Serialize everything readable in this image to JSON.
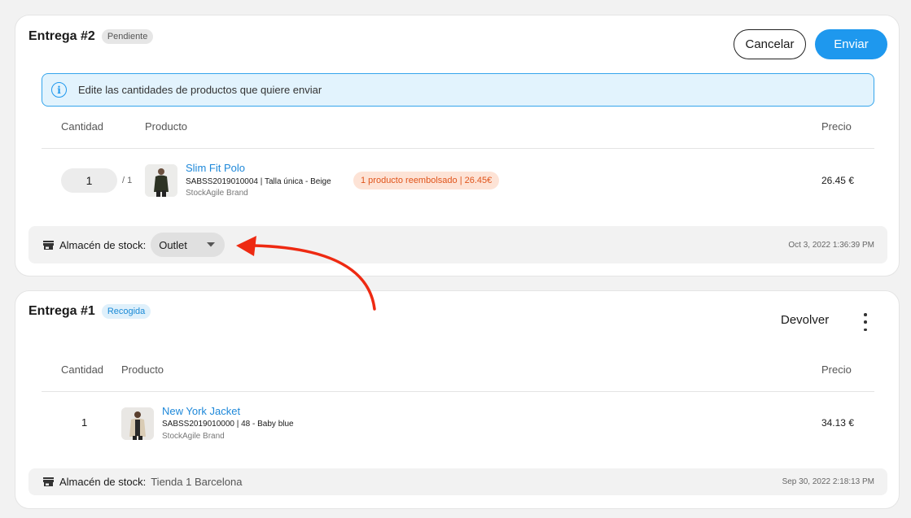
{
  "shipment2": {
    "title": "Entrega #2",
    "status": "Pendiente",
    "cancel_label": "Cancelar",
    "send_label": "Enviar",
    "info_text": "Edite las cantidades de productos que quiere enviar",
    "headers": {
      "quantity": "Cantidad",
      "product": "Producto",
      "price": "Precio"
    },
    "item": {
      "quantity": "1",
      "quantity_max": "/ 1",
      "name": "Slim Fit Polo",
      "sku": "SABSS2019010004 | Talla única - Beige",
      "brand": "StockAgile Brand",
      "refund_badge": "1 producto reembolsado | 26.45€",
      "price": "26.45 €"
    },
    "warehouse_label": "Almacén de stock:",
    "warehouse_value": "Outlet",
    "timestamp": "Oct 3, 2022 1:36:39 PM"
  },
  "shipment1": {
    "title": "Entrega #1",
    "status": "Recogida",
    "return_label": "Devolver",
    "headers": {
      "quantity": "Cantidad",
      "product": "Producto",
      "price": "Precio"
    },
    "item": {
      "quantity": "1",
      "name": "New York Jacket",
      "sku": "SABSS2019010000 | 48 - Baby blue",
      "brand": "StockAgile Brand",
      "price": "34.13 €"
    },
    "warehouse_label": "Almacén de stock:",
    "warehouse_value": "Tienda 1 Barcelona",
    "timestamp": "Sep 30, 2022 2:18:13 PM"
  },
  "icons": [
    "info-icon",
    "store-icon",
    "chevron-down-icon",
    "kebab-menu-icon",
    "annotation-arrow"
  ],
  "colors": {
    "accent": "#1e98ee",
    "link": "#1e88d9",
    "refund_text": "#e0541b",
    "refund_bg": "#fde3d6",
    "annotation_arrow": "#ee2a12"
  }
}
